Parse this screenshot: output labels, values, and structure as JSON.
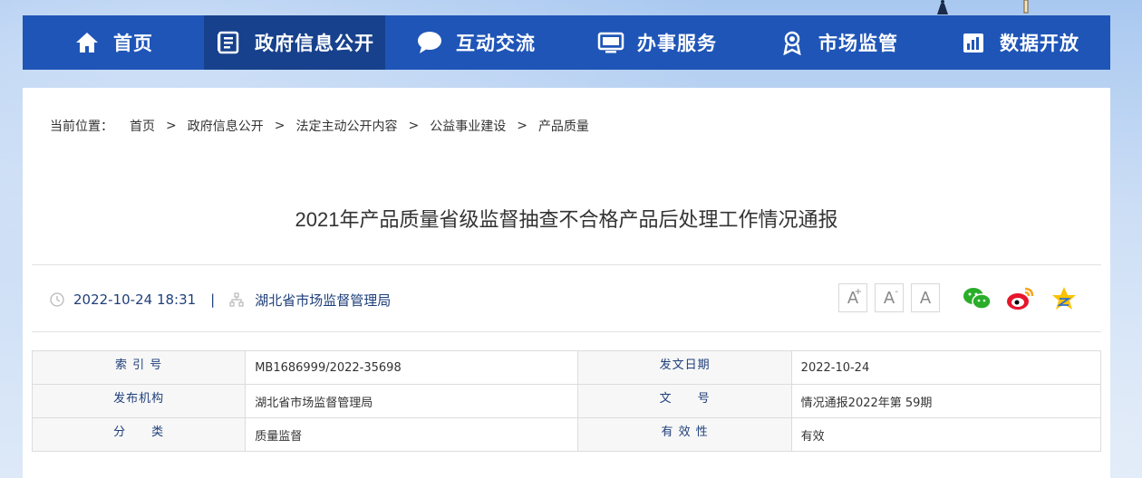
{
  "nav": {
    "items": [
      {
        "label": "首页",
        "icon": "home-icon"
      },
      {
        "label": "政府信息公开",
        "icon": "document-icon",
        "active": true
      },
      {
        "label": "互动交流",
        "icon": "chat-bubble-icon"
      },
      {
        "label": "办事服务",
        "icon": "monitor-icon"
      },
      {
        "label": "市场监管",
        "icon": "badge-icon"
      },
      {
        "label": "数据开放",
        "icon": "bar-chart-icon"
      }
    ]
  },
  "breadcrumb": {
    "lead": "当前位置：",
    "sep": ">",
    "items": [
      "首页",
      "政府信息公开",
      "法定主动公开内容",
      "公益事业建设",
      "产品质量"
    ]
  },
  "article": {
    "title": "2021年产品质量省级监督抽查不合格产品后处理工作情况通报",
    "datetime": "2022-10-24 18:31",
    "pipe": "|",
    "org": "湖北省市场监督管理局"
  },
  "font_controls": {
    "larger": "A",
    "larger_mark": "+",
    "smaller": "A",
    "smaller_mark": "-",
    "normal": "A"
  },
  "share": {
    "icons": [
      "wechat-icon",
      "weibo-icon",
      "qzone-icon"
    ]
  },
  "info_table": {
    "rows": [
      {
        "label1": "索 引 号",
        "value1": "MB1686999/2022-35698",
        "label2": "发文日期",
        "value2": "2022-10-24"
      },
      {
        "label1": "发布机构",
        "value1": "湖北省市场监督管理局",
        "label2": "文　　号",
        "value2": "情况通报2022年第 59期"
      },
      {
        "label1": "分　　类",
        "value1": "质量监督",
        "label2": "有 效 性",
        "value2": "有效"
      }
    ]
  },
  "colors": {
    "nav_bg": "#1f55b7",
    "nav_active": "#17418c",
    "accent_text": "#1f3f7a"
  }
}
